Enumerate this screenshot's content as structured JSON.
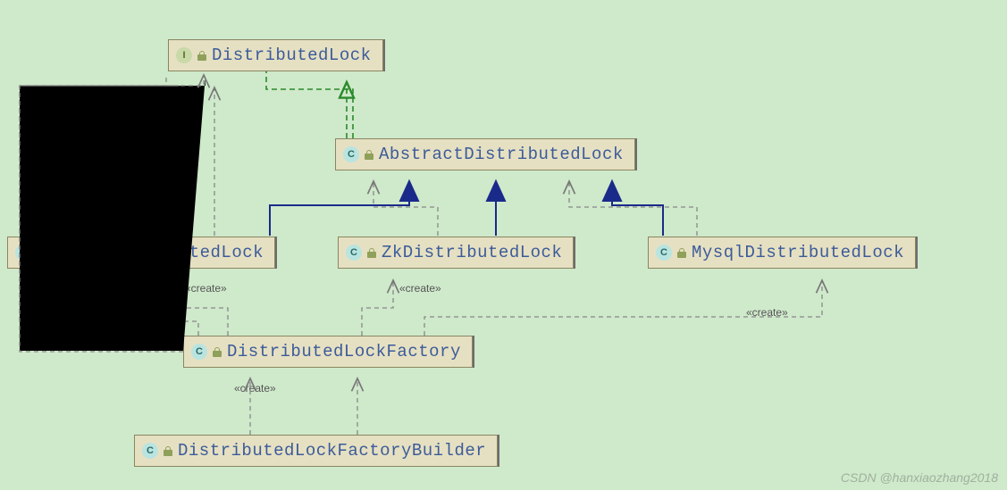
{
  "diagram": {
    "nodes": {
      "distributedLock": {
        "name": "DistributedLock",
        "kind": "I"
      },
      "abstractDistributedLock": {
        "name": "AbstractDistributedLock",
        "kind": "C"
      },
      "redisDistributedLock": {
        "name": "RedisDistributedLock",
        "kind": "C"
      },
      "zkDistributedLock": {
        "name": "ZkDistributedLock",
        "kind": "C"
      },
      "mysqlDistributedLock": {
        "name": "MysqlDistributedLock",
        "kind": "C"
      },
      "distributedLockFactory": {
        "name": "DistributedLockFactory",
        "kind": "C"
      },
      "distributedLockFactoryBuilder": {
        "name": "DistributedLockFactoryBuilder",
        "kind": "C"
      }
    },
    "edges": [
      {
        "from": "abstractDistributedLock",
        "to": "distributedLock",
        "type": "realization"
      },
      {
        "from": "redisDistributedLock",
        "to": "abstractDistributedLock",
        "type": "generalization"
      },
      {
        "from": "zkDistributedLock",
        "to": "abstractDistributedLock",
        "type": "generalization"
      },
      {
        "from": "mysqlDistributedLock",
        "to": "abstractDistributedLock",
        "type": "generalization"
      },
      {
        "from": "redisDistributedLock",
        "to": "distributedLock",
        "type": "dependency"
      },
      {
        "from": "zkDistributedLock",
        "to": "abstractDistributedLock",
        "type": "dependency"
      },
      {
        "from": "mysqlDistributedLock",
        "to": "abstractDistributedLock",
        "type": "dependency"
      },
      {
        "from": "distributedLockFactory",
        "to": "redisDistributedLock",
        "type": "create"
      },
      {
        "from": "distributedLockFactory",
        "to": "zkDistributedLock",
        "type": "create"
      },
      {
        "from": "distributedLockFactory",
        "to": "mysqlDistributedLock",
        "type": "create"
      },
      {
        "from": "distributedLockFactory",
        "to": "distributedLock",
        "type": "dependency"
      },
      {
        "from": "distributedLockFactoryBuilder",
        "to": "distributedLockFactory",
        "type": "create"
      },
      {
        "from": "distributedLockFactoryBuilder",
        "to": "abstractDistributedLock",
        "type": "dependency"
      }
    ],
    "labels": {
      "create1": "«create»",
      "create2": "«create»",
      "create3": "«create»",
      "create4": "«create»"
    }
  },
  "watermark": "CSDN @hanxiaozhang2018"
}
